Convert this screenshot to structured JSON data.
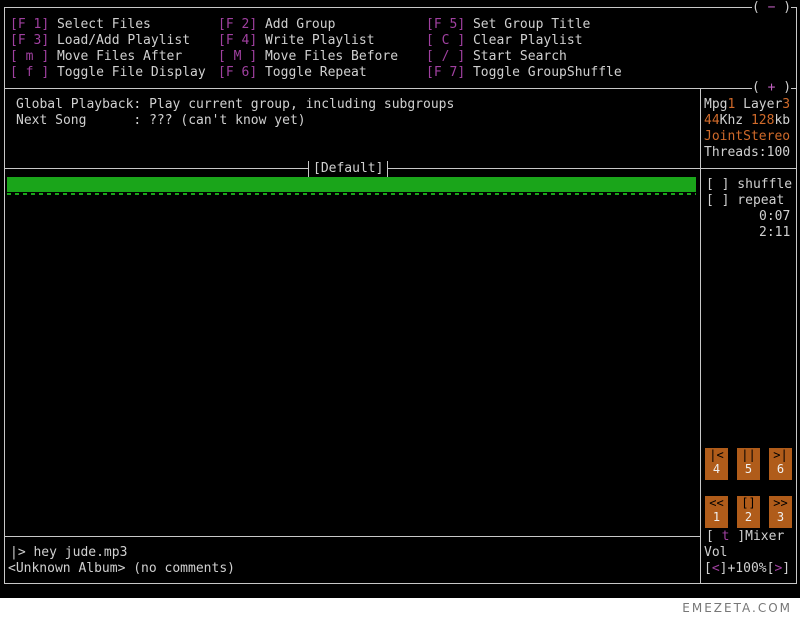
{
  "window": {
    "minus_button": "−",
    "plus_button": "+"
  },
  "shortcuts": [
    {
      "key": "F 1",
      "label": "Select Files"
    },
    {
      "key": "F 3",
      "label": "Load/Add Playlist"
    },
    {
      "key": " m ",
      "label": "Move Files After"
    },
    {
      "key": " f ",
      "label": "Toggle File Display"
    },
    {
      "key": "F 2",
      "label": "Add Group"
    },
    {
      "key": "F 4",
      "label": "Write Playlist"
    },
    {
      "key": " M ",
      "label": "Move Files Before"
    },
    {
      "key": "F 6",
      "label": "Toggle Repeat"
    },
    {
      "key": "F 5",
      "label": "Set Group Title"
    },
    {
      "key": " C ",
      "label": "Clear Playlist"
    },
    {
      "key": " / ",
      "label": "Start Search"
    },
    {
      "key": "F 7",
      "label": "Toggle GroupShuffle"
    }
  ],
  "status": {
    "playback_label": "Global Playback",
    "playback_value": "Play current group, including subgroups",
    "next_label": "Next Song      ",
    "next_value": "??? (can't know yet)"
  },
  "stream": {
    "codec": "Mpg",
    "codec_ver": "1",
    "layer_label": "Layer",
    "layer_val": "3",
    "khz_val": "44",
    "khz_unit": "Khz",
    "kb_val": "128",
    "kb_unit": "kb",
    "mode": "JointStereo",
    "threads": "Threads:100"
  },
  "playlist": {
    "group_title": "[Default]",
    "items": [
      "hey jude.mp3"
    ]
  },
  "options": {
    "shuffle": "[ ] shuffle",
    "repeat": "[ ] repeat",
    "elapsed": "0:07",
    "total": "2:11"
  },
  "controls": [
    {
      "symbol": "|<",
      "num": "4"
    },
    {
      "symbol": "||",
      "num": "5"
    },
    {
      "symbol": ">|",
      "num": "6"
    },
    {
      "symbol": "<<",
      "num": "1"
    },
    {
      "symbol": "[]",
      "num": "2"
    },
    {
      "symbol": ">>",
      "num": "3"
    }
  ],
  "mixer": {
    "key": " t ",
    "label": "Mixer",
    "vol_label": "Vol",
    "vol_down": "<",
    "vol_value": "+100%",
    "vol_up": ">"
  },
  "now_playing": {
    "prompt": "|>",
    "title": "hey jude.mp3",
    "info": "<Unknown Album> (no comments)"
  },
  "watermark": "EMEZETA.COM"
}
